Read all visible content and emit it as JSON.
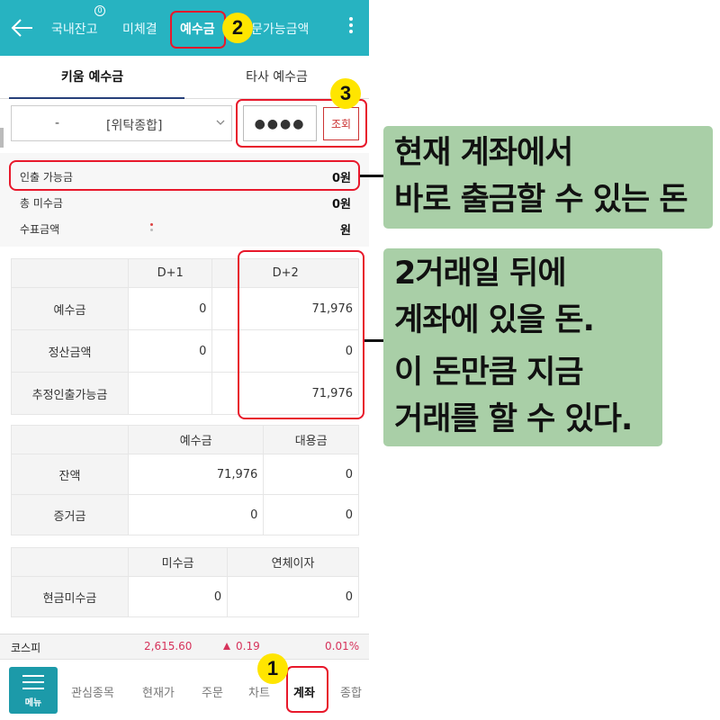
{
  "top_tabs": {
    "domestic": "국내잔고",
    "unsettled": "미체결",
    "deposit": "예수금",
    "orderable": "문가능금액",
    "badge": "0"
  },
  "sub_tabs": {
    "kiwoom": "키움 예수금",
    "other": "타사 예수금"
  },
  "account": {
    "dash": "-",
    "type": "[위탁종합]",
    "password_mask": "●●●●",
    "inquiry_label": "조회"
  },
  "summary": [
    {
      "label": "인출 가능금",
      "value": "0원"
    },
    {
      "label": "총 미수금",
      "value": "0원"
    },
    {
      "label": "수표금액",
      "value": "원"
    }
  ],
  "table_settlement": {
    "headers": [
      "",
      "D+1",
      "D+2"
    ],
    "rows": [
      {
        "label": "예수금",
        "d1": "0",
        "d2": "71,976"
      },
      {
        "label": "정산금액",
        "d1": "0",
        "d2": "0"
      },
      {
        "label": "추정인출가능금",
        "d1": "",
        "d2": "71,976"
      }
    ]
  },
  "table_balance": {
    "headers": [
      "",
      "예수금",
      "대용금"
    ],
    "rows": [
      {
        "label": "잔액",
        "c1": "71,976",
        "c2": "0"
      },
      {
        "label": "증거금",
        "c1": "0",
        "c2": "0"
      }
    ]
  },
  "table_receivable": {
    "headers": [
      "",
      "미수금",
      "연체이자"
    ],
    "rows": [
      {
        "label": "현금미수금",
        "c1": "0",
        "c2": "0"
      }
    ]
  },
  "index_bar": {
    "name": "코스피",
    "value": "2,615.60",
    "change": "0.19",
    "pct": "0.01%"
  },
  "bottom_nav": {
    "menu": "메뉴",
    "watchlist": "관심종목",
    "current": "현재가",
    "order": "주문",
    "chart": "차트",
    "account": "계좌",
    "more": "종합"
  },
  "markers": [
    "1",
    "2",
    "3"
  ],
  "callouts": {
    "withdraw": [
      "현재 계좌에서",
      "바로 출금할 수 있는 돈"
    ],
    "d2": [
      "2거래일 뒤에",
      "계좌에 있을 돈.",
      "이 돈만큼 지금",
      "거래를 할 수 있다."
    ]
  },
  "colors": {
    "primary": "#27b3c1",
    "highlight": "#e8182b",
    "marker": "#ffe500",
    "callout": "#a9cfa7",
    "up": "#d6335b"
  }
}
